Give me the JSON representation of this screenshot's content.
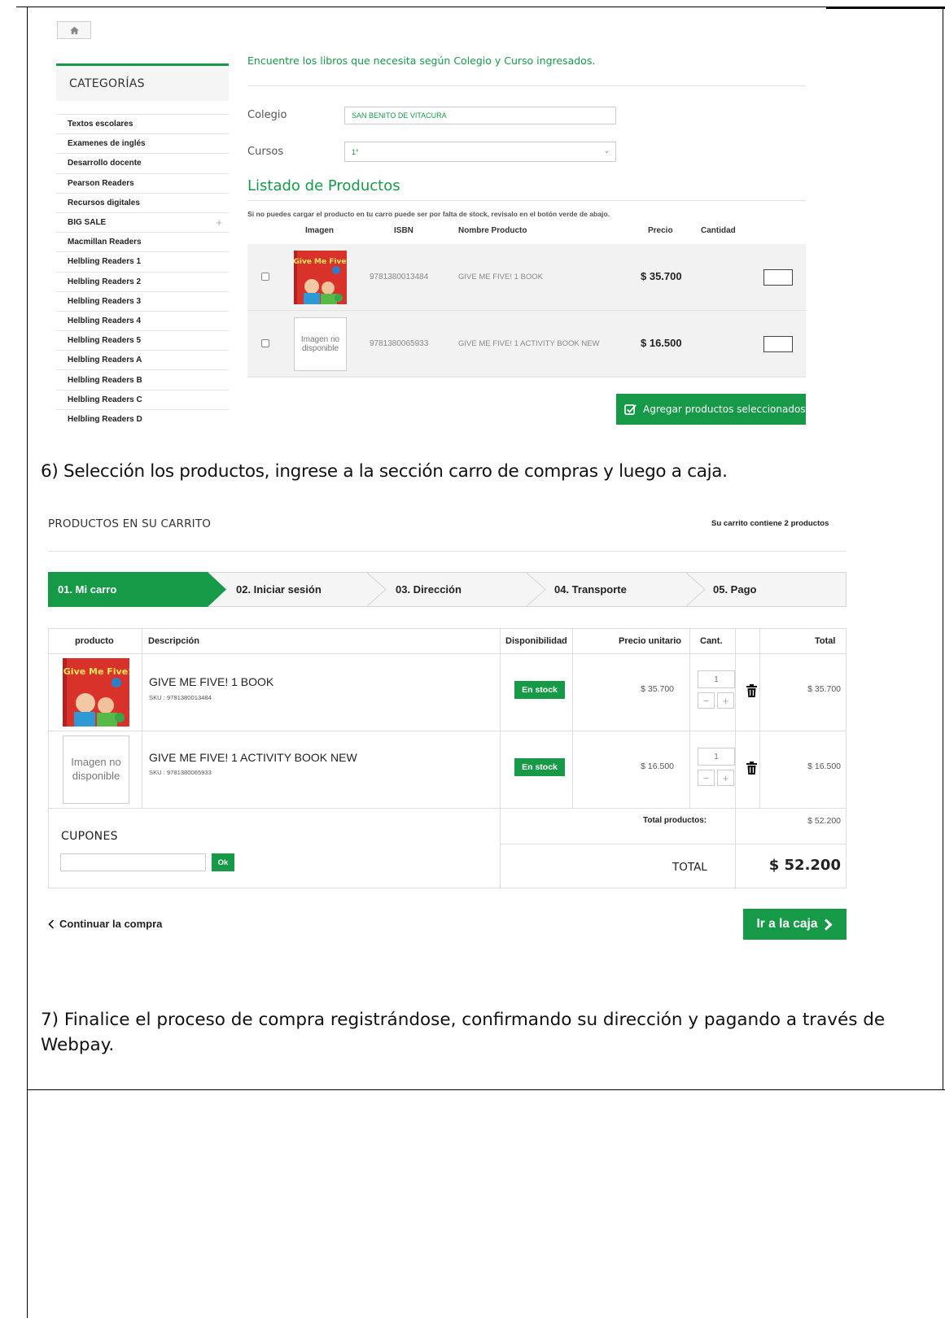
{
  "catalog": {
    "categories_title": "CATEGORÍAS",
    "categories": [
      {
        "label": "Textos escolares"
      },
      {
        "label": "Examenes de inglés"
      },
      {
        "label": "Desarrollo docente"
      },
      {
        "label": "Pearson Readers"
      },
      {
        "label": "Recursos digitales"
      },
      {
        "label": "BIG SALE",
        "expand": "+"
      },
      {
        "label": "Macmillan Readers"
      },
      {
        "label": "Helbling Readers 1"
      },
      {
        "label": "Helbling Readers 2"
      },
      {
        "label": "Helbling Readers 3"
      },
      {
        "label": "Helbling Readers 4"
      },
      {
        "label": "Helbling Readers 5"
      },
      {
        "label": "Helbling Readers A"
      },
      {
        "label": "Helbling Readers B"
      },
      {
        "label": "Helbling Readers C"
      },
      {
        "label": "Helbling Readers D"
      }
    ],
    "intro": "Encuentre los libros que necesita según Colegio y Curso ingresados.",
    "colegio_label": "Colegio",
    "colegio_value": "SAN BENITO DE VITACURA",
    "cursos_label": "Cursos",
    "cursos_value": "1°",
    "listado_title": "Listado de Productos",
    "stock_note": "Si no puedes cargar el producto en tu carro puede ser por falta de stock, revisalo en el botón verde de abajo.",
    "columns": {
      "imagen": "Imagen",
      "isbn": "ISBN",
      "nombre": "Nombre Producto",
      "precio": "Precio",
      "cantidad": "Cantidad"
    },
    "products": [
      {
        "isbn": "9781380013484",
        "name": "GIVE ME FIVE! 1 BOOK",
        "price": "$ 35.700",
        "cover_text": "Give Me Five!"
      },
      {
        "isbn": "9781380065933",
        "name": "GIVE ME FIVE! 1 ACTIVITY BOOK NEW",
        "price": "$ 16.500",
        "no_image": "Imagen no disponible"
      }
    ],
    "add_button": "Agregar productos seleccionados"
  },
  "instructions": {
    "step6": "6) Selección los productos, ingrese a la sección carro de compras y luego a caja.",
    "step7": "7) Finalice el proceso de compra registrándose, confirmando su dirección y pagando a través de Webpay."
  },
  "cart": {
    "title": "PRODUCTOS EN SU CARRITO",
    "count_text": "Su carrito contiene 2 productos",
    "steps": [
      "01. Mi carro",
      "02. Iniciar sesión",
      "03. Dirección",
      "04. Transporte",
      "05. Pago"
    ],
    "active_step": 0,
    "columns": {
      "producto": "producto",
      "descripcion": "Descripción",
      "disponibilidad": "Disponibilidad",
      "precio_unitario": "Precio unitario",
      "cant": "Cant.",
      "total": "Total"
    },
    "items": [
      {
        "name": "GIVE ME FIVE! 1 BOOK",
        "sku": "SKU : 9781380013484",
        "availability": "En stock",
        "unit_price": "$ 35.700",
        "qty": "1",
        "total": "$ 35.700",
        "cover_text": "Give Me Five!"
      },
      {
        "name": "GIVE ME FIVE! 1 ACTIVITY BOOK NEW",
        "sku": "SKU : 9781380065933",
        "availability": "En stock",
        "unit_price": "$ 16.500",
        "qty": "1",
        "total": "$ 16.500",
        "no_image": "Imagen no disponible"
      }
    ],
    "qty_minus": "−",
    "qty_plus": "+",
    "coupons_title": "CUPONES",
    "ok_label": "Ok",
    "total_products_label": "Total productos:",
    "total_products_value": "$ 52.200",
    "total_label": "TOTAL",
    "total_value": "$ 52.200",
    "continue_label": "Continuar la compra",
    "checkout_label": "Ir a la caja"
  },
  "colors": {
    "accent": "#169a48",
    "cover_red": "#d9322b"
  }
}
